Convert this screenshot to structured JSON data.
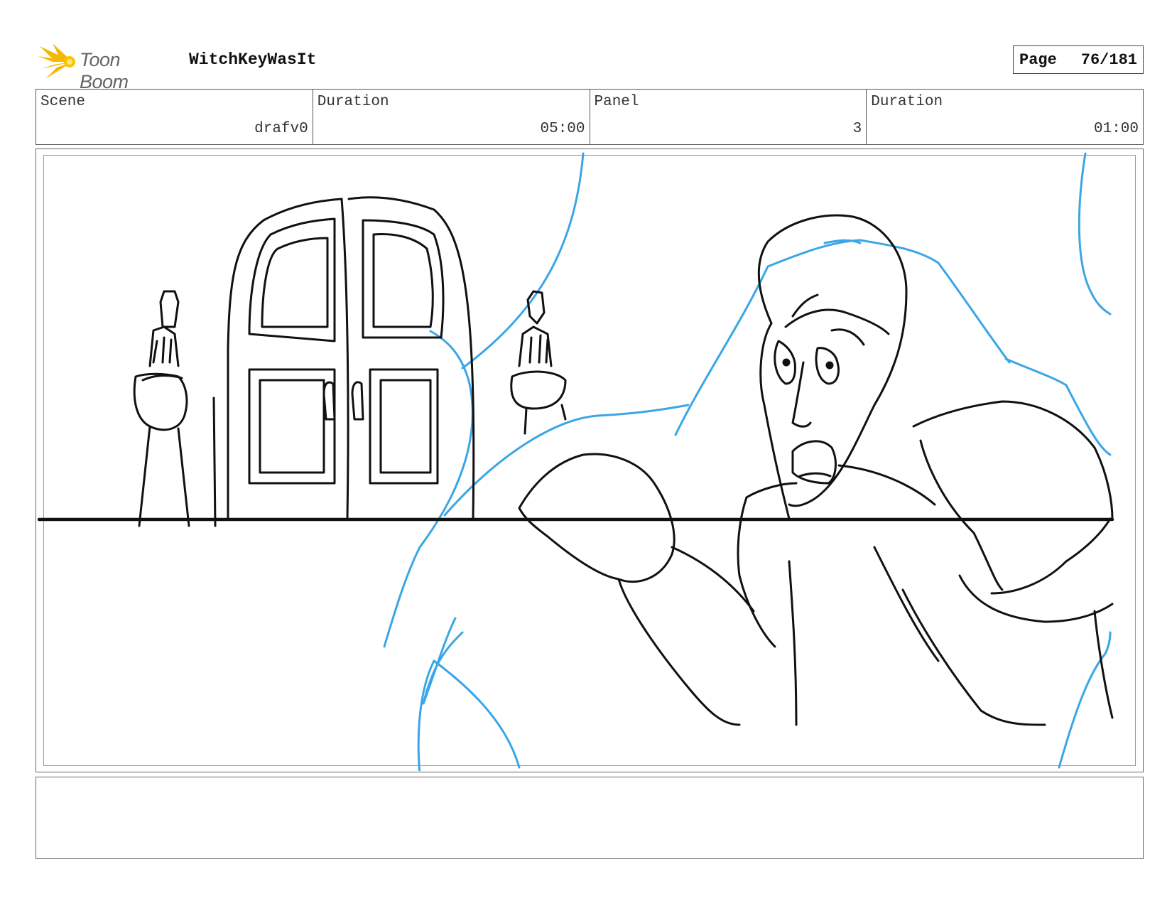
{
  "header": {
    "logo_text": "Toon Boom",
    "project_title": "WitchKeyWasIt",
    "page_label": "Page",
    "page_number": "76/181"
  },
  "info": {
    "scene_label": "Scene",
    "scene_value": "drafv0",
    "scene_duration_label": "Duration",
    "scene_duration_value": "05:00",
    "panel_label": "Panel",
    "panel_value": "3",
    "panel_duration_label": "Duration",
    "panel_duration_value": "01:00"
  },
  "notes": {
    "text": ""
  },
  "colors": {
    "sketch_black": "#111111",
    "sketch_blue": "#3aa6e6",
    "logo_yellow": "#f5b800"
  }
}
